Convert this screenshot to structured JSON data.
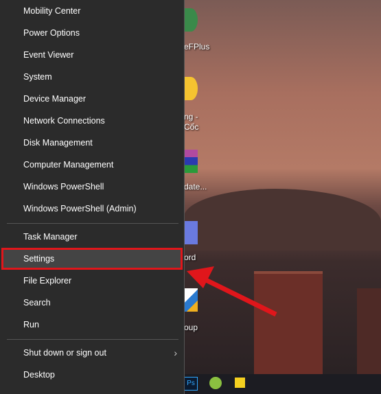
{
  "menu": {
    "items": [
      {
        "label": "Mobility Center"
      },
      {
        "label": "Power Options"
      },
      {
        "label": "Event Viewer"
      },
      {
        "label": "System"
      },
      {
        "label": "Device Manager"
      },
      {
        "label": "Network Connections"
      },
      {
        "label": "Disk Management"
      },
      {
        "label": "Computer Management"
      },
      {
        "label": "Windows PowerShell"
      },
      {
        "label": "Windows PowerShell (Admin)"
      },
      {
        "label": "Task Manager"
      },
      {
        "label": "Settings",
        "highlighted": true
      },
      {
        "label": "File Explorer"
      },
      {
        "label": "Search"
      },
      {
        "label": "Run"
      },
      {
        "label": "Shut down or sign out",
        "submenu": true
      },
      {
        "label": "Desktop"
      }
    ]
  },
  "desktop": {
    "icons": [
      {
        "label": "eFPlus"
      },
      {
        "label": "ng -"
      },
      {
        "label": "Cốc"
      },
      {
        "label": "date..."
      },
      {
        "label": "ord"
      },
      {
        "label": "oup"
      }
    ]
  },
  "taskbar": {
    "ps_label": "Ps"
  },
  "colors": {
    "highlight": "#e0161b",
    "menu_bg": "#2b2b2b"
  }
}
